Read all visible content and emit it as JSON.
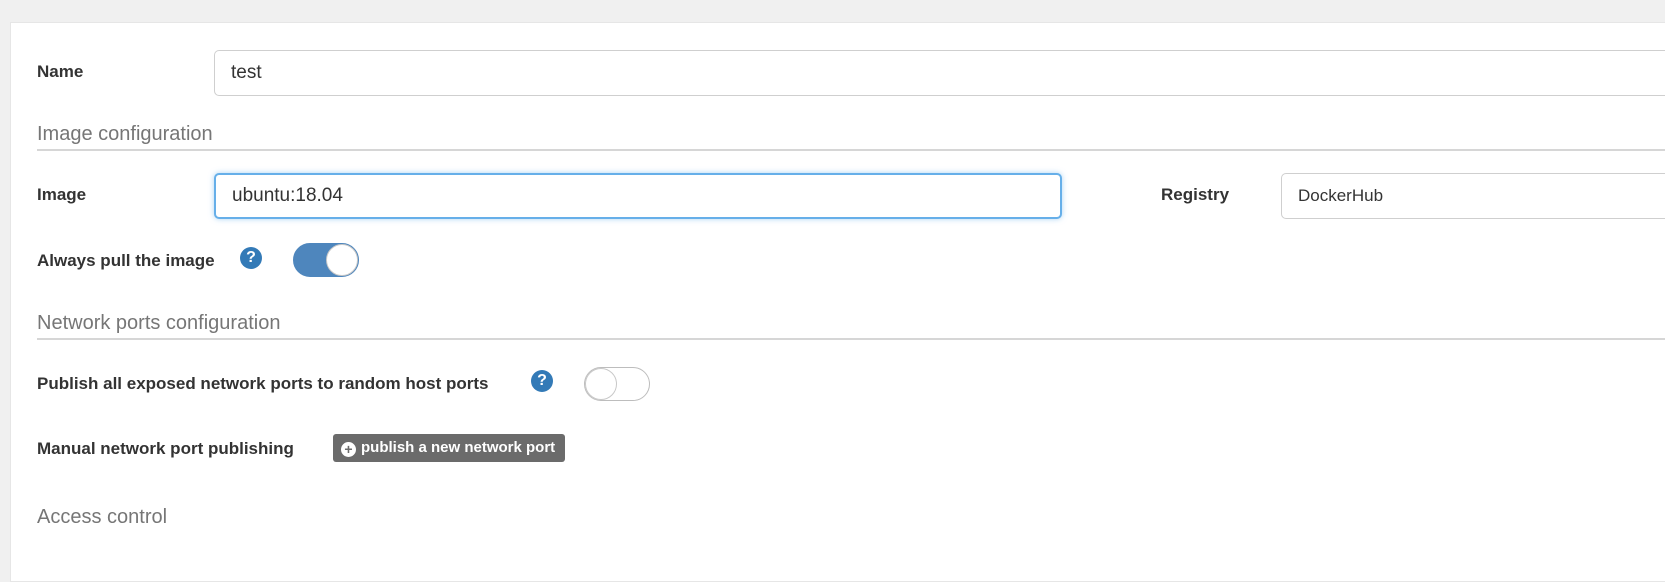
{
  "form": {
    "name_label": "Name",
    "name_value": "test",
    "image_config_title": "Image configuration",
    "image_label": "Image",
    "image_value": "ubuntu:18.04",
    "registry_label": "Registry",
    "registry_value": "DockerHub",
    "always_pull_label": "Always pull the image",
    "always_pull_enabled": true,
    "network_ports_title": "Network ports configuration",
    "publish_all_label": "Publish all exposed network ports to random host ports",
    "publish_all_enabled": false,
    "manual_publishing_label": "Manual network port publishing",
    "publish_button_label": "publish a new network port",
    "access_control_title": "Access control"
  },
  "icons": {
    "help": "question-circle-icon",
    "plus": "plus-circle-icon"
  },
  "colors": {
    "toggle_on": "#4e86bd",
    "help_icon": "#337ab7",
    "focus_border": "#66afe9",
    "publish_button": "#6b6b6b"
  }
}
